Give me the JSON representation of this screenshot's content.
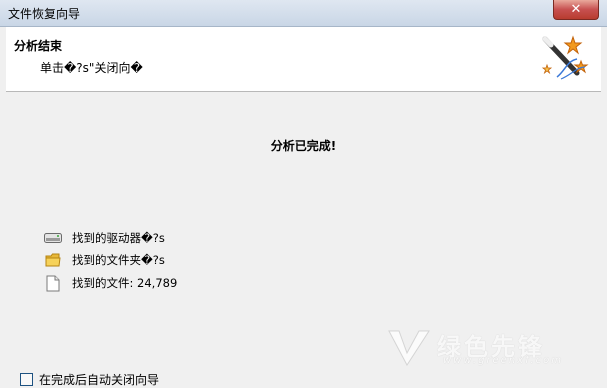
{
  "window": {
    "title": "文件恢复向导",
    "close_glyph": "✕"
  },
  "header": {
    "title": "分析结束",
    "subtitle": "单击�?s\"关闭向�",
    "icon": "magic-wand-icon"
  },
  "main": {
    "status": "分析已完成!",
    "results": [
      {
        "icon": "drive-icon",
        "label": "找到的驱动器�?s"
      },
      {
        "icon": "folder-icon",
        "label": "找到的文件夹�?s"
      },
      {
        "icon": "file-icon",
        "label": "找到的文件: 24,789"
      }
    ]
  },
  "footer": {
    "checkbox_label": "在完成后自动关闭向导",
    "checkbox_checked": false
  },
  "watermark": {
    "text": "绿色先锋",
    "url": "www.greenxf.com"
  }
}
